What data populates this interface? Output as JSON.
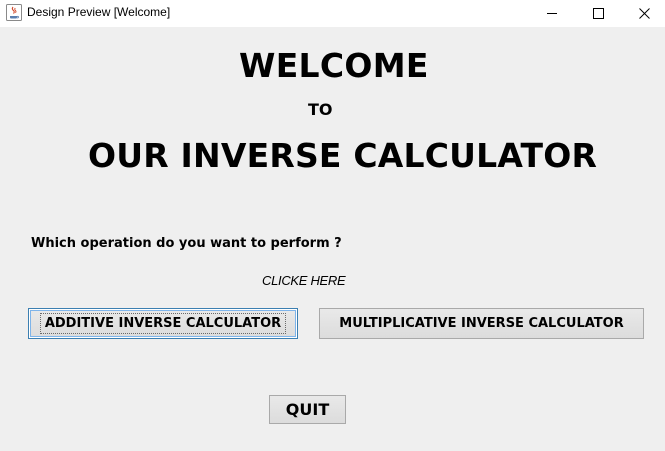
{
  "window": {
    "title": "Design Preview [Welcome]",
    "icon": "java-cup-icon",
    "controls": [
      "minimize-icon",
      "maximize-icon",
      "close-icon"
    ]
  },
  "content": {
    "welcome": "WELCOME",
    "to": "TO",
    "headline": "OUR INVERSE CALCULATOR",
    "question": "Which operation do you want to perform ?",
    "click_hint": "CLICKE HERE"
  },
  "buttons": {
    "additive": "ADDITIVE INVERSE CALCULATOR",
    "multiplicative": "MULTIPLICATIVE INVERSE CALCULATOR",
    "quit": "QUIT"
  },
  "colors": {
    "panel_background": "#efefef",
    "focus_border": "#3c7fb1",
    "button_border": "#a9a9a9"
  }
}
